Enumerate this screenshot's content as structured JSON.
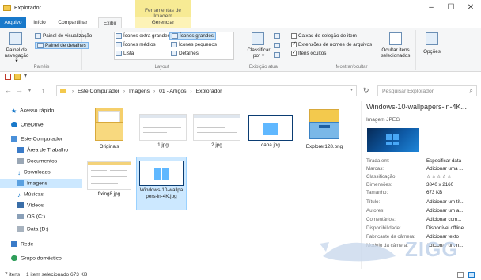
{
  "window": {
    "title": "Explorador",
    "contextual_tab": "Ferramentas de Imagem"
  },
  "controls": {
    "minimize": "–",
    "maximize": "☐",
    "close": "✕"
  },
  "tabs": {
    "file": "Arquivo",
    "home": "Início",
    "share": "Compartilhar",
    "view": "Exibir",
    "manage": "Gerenciar"
  },
  "ribbon": {
    "panes": {
      "nav_pane": "Painel de navegação ▾",
      "preview": "Painel de visualização",
      "details": "Painel de detalhes",
      "title": "Painéis"
    },
    "layout": {
      "items": [
        "Ícones extra grandes",
        "Ícones grandes",
        "Ícones médios",
        "Ícones pequenos",
        "Lista",
        "Detalhes"
      ],
      "selected": "Ícones grandes",
      "title": "Layout"
    },
    "current_view": {
      "sort": "Classificar por ▾",
      "title": "Exibição atual"
    },
    "show_hide": {
      "checkboxes": [
        {
          "label": "Caixas de seleção de item",
          "checked": false
        },
        {
          "label": "Extensões de nomes de arquivos",
          "checked": true
        },
        {
          "label": "Itens ocultos",
          "checked": true
        }
      ],
      "hide": "Ocultar itens selecionados",
      "title": "Mostrar/ocultar"
    },
    "options": "Opções"
  },
  "quick_access_toolbar": {
    "dropdown": "▾"
  },
  "address": {
    "segments": [
      "Este Computador",
      "Imagens",
      "01 - Artigos",
      "Explorador"
    ],
    "search_placeholder": "Pesquisar Explorador"
  },
  "sidebar": [
    {
      "label": "Acesso rápido"
    },
    {
      "label": "OneDrive"
    },
    {
      "label": "Este Computador"
    },
    {
      "label": "Área de Trabalho"
    },
    {
      "label": "Documentos"
    },
    {
      "label": "Downloads"
    },
    {
      "label": "Imagens",
      "selected": true
    },
    {
      "label": "Músicas"
    },
    {
      "label": "Vídeos"
    },
    {
      "label": "OS (C:)"
    },
    {
      "label": "Data (D:)"
    },
    {
      "label": "Rede"
    },
    {
      "label": "Grupo doméstico"
    }
  ],
  "files": [
    {
      "name": "Originais",
      "kind": "folder"
    },
    {
      "name": "1.jpg",
      "kind": "screenshot"
    },
    {
      "name": "2.jpg",
      "kind": "screenshot"
    },
    {
      "name": "capa.jpg",
      "kind": "wallpaper"
    },
    {
      "name": "Explorer128.png",
      "kind": "explorer-icon"
    },
    {
      "name": "fixing8.jpg",
      "kind": "screenshot"
    },
    {
      "name": "Windows-10-wallpapers-in-4K.jpg",
      "kind": "wallpaper",
      "selected": true
    }
  ],
  "details": {
    "title": "Windows-10-wallpapers-in-4K...",
    "type": "Imagem JPEG",
    "properties": [
      {
        "key": "Tirada em:",
        "value": "Especificar data"
      },
      {
        "key": "Marcas:",
        "value": "Adicionar uma ..."
      },
      {
        "key": "Classificação:",
        "value": "☆☆☆☆☆"
      },
      {
        "key": "Dimensões:",
        "value": "3840 x 2160"
      },
      {
        "key": "Tamanho:",
        "value": "673 KB"
      },
      {
        "key": "Título:",
        "value": "Adicionar um tít..."
      },
      {
        "key": "Autores:",
        "value": "Adicionar um a..."
      },
      {
        "key": "Comentários:",
        "value": "Adicionar com..."
      },
      {
        "key": "Disponibilidade:",
        "value": "Disponível offline"
      },
      {
        "key": "Fabricante da câmera:",
        "value": "Adicionar texto"
      },
      {
        "key": "Modelo da câmera:",
        "value": "Adicionar um n..."
      }
    ]
  },
  "status": {
    "count": "7 itens",
    "selection": "1 item selecionado  673 KB"
  },
  "watermark": {
    "text": "ZIGG"
  },
  "colors": {
    "accent": "#1979ca",
    "selection": "#cce8ff",
    "manage_tab": "#f7ea94"
  }
}
